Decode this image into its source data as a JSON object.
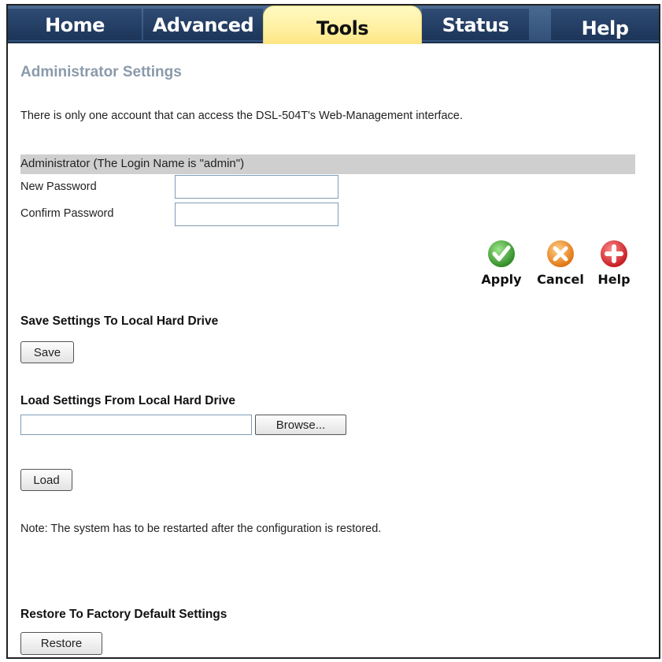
{
  "tabs": [
    {
      "label": "Home"
    },
    {
      "label": "Advanced"
    },
    {
      "label": "Tools"
    },
    {
      "label": "Status"
    },
    {
      "label": "Help"
    }
  ],
  "page": {
    "title": "Administrator Settings",
    "description": "There is only one account that can access the DSL-504T's Web-Management interface."
  },
  "admin": {
    "band_label": "Administrator (The Login Name is \"admin\")",
    "new_password_label": "New Password",
    "confirm_password_label": "Confirm Password",
    "new_password_value": "",
    "confirm_password_value": ""
  },
  "actions": {
    "apply_label": "Apply",
    "cancel_label": "Cancel",
    "help_label": "Help"
  },
  "save_section": {
    "title": "Save Settings To Local Hard Drive",
    "button_label": "Save"
  },
  "load_section": {
    "title": "Load Settings From Local Hard Drive",
    "file_value": "",
    "browse_label": "Browse...",
    "load_label": "Load",
    "note": "Note: The system has to be restarted after the configuration is restored."
  },
  "restore_section": {
    "title": "Restore To Factory Default Settings",
    "button_label": "Restore"
  },
  "colors": {
    "tabbar": "#31507a",
    "active_tab": "#fff0a0",
    "heading": "#8a9aab",
    "apply": "#3aa832",
    "cancel": "#f08a1c",
    "help": "#d9262c"
  }
}
